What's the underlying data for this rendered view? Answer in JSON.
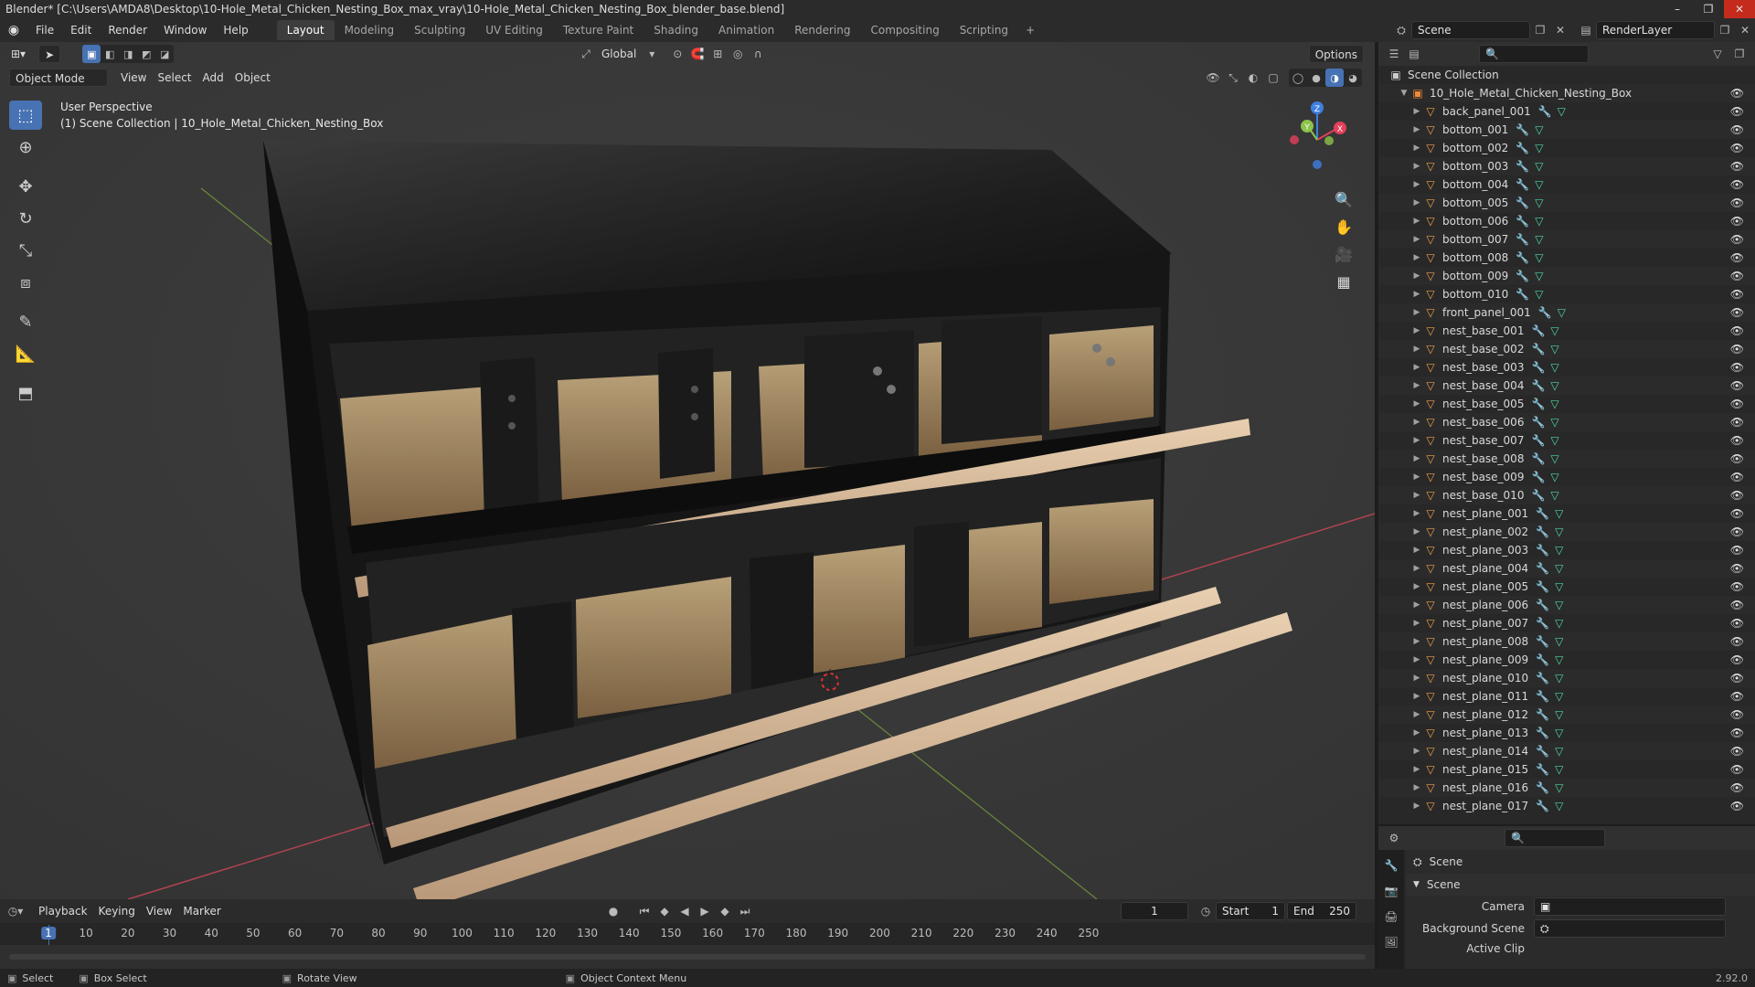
{
  "window": {
    "title": "Blender* [C:\\Users\\AMDA8\\Desktop\\10-Hole_Metal_Chicken_Nesting_Box_max_vray\\10-Hole_Metal_Chicken_Nesting_Box_blender_base.blend]",
    "controls": [
      "–",
      "❐",
      "✕"
    ]
  },
  "menu": [
    "File",
    "Edit",
    "Render",
    "Window",
    "Help"
  ],
  "workspaces": [
    {
      "label": "Layout",
      "active": true
    },
    {
      "label": "Modeling"
    },
    {
      "label": "Sculpting"
    },
    {
      "label": "UV Editing"
    },
    {
      "label": "Texture Paint"
    },
    {
      "label": "Shading"
    },
    {
      "label": "Animation"
    },
    {
      "label": "Rendering"
    },
    {
      "label": "Compositing"
    },
    {
      "label": "Scripting"
    }
  ],
  "topright": {
    "scene": "Scene",
    "view_layer": "RenderLayer"
  },
  "viewport": {
    "transform_orientation": "Global",
    "options_label": "Options",
    "mode": "Object Mode",
    "menus": [
      "View",
      "Select",
      "Add",
      "Object"
    ],
    "perspective_label": "User Perspective",
    "collection_label": "(1) Scene Collection | 10_Hole_Metal_Chicken_Nesting_Box"
  },
  "outliner": {
    "root": "Scene Collection",
    "collection": "10_Hole_Metal_Chicken_Nesting_Box",
    "items": [
      "back_panel_001",
      "bottom_001",
      "bottom_002",
      "bottom_003",
      "bottom_004",
      "bottom_005",
      "bottom_006",
      "bottom_007",
      "bottom_008",
      "bottom_009",
      "bottom_010",
      "front_panel_001",
      "nest_base_001",
      "nest_base_002",
      "nest_base_003",
      "nest_base_004",
      "nest_base_005",
      "nest_base_006",
      "nest_base_007",
      "nest_base_008",
      "nest_base_009",
      "nest_base_010",
      "nest_plane_001",
      "nest_plane_002",
      "nest_plane_003",
      "nest_plane_004",
      "nest_plane_005",
      "nest_plane_006",
      "nest_plane_007",
      "nest_plane_008",
      "nest_plane_009",
      "nest_plane_010",
      "nest_plane_011",
      "nest_plane_012",
      "nest_plane_013",
      "nest_plane_014",
      "nest_plane_015",
      "nest_plane_016",
      "nest_plane_017"
    ]
  },
  "properties": {
    "context": "Scene",
    "panel": "Scene",
    "camera_label": "Camera",
    "background_label": "Background Scene",
    "clip_label": "Active Clip"
  },
  "timeline": {
    "menus": [
      "Playback",
      "Keying",
      "View",
      "Marker"
    ],
    "current_frame": "1",
    "start_label": "Start",
    "start": "1",
    "end_label": "End",
    "end": "250",
    "ticks": [
      "1",
      "10",
      "20",
      "30",
      "40",
      "50",
      "60",
      "70",
      "80",
      "90",
      "100",
      "110",
      "120",
      "130",
      "140",
      "150",
      "160",
      "170",
      "180",
      "190",
      "200",
      "210",
      "220",
      "230",
      "240",
      "250"
    ]
  },
  "status": {
    "items": [
      "Select",
      "Box Select",
      "Rotate View",
      "Object Context Menu"
    ],
    "version": "2.92.0"
  },
  "colors": {
    "accent": "#4772b3",
    "object_orange": "#f0a04b",
    "mesh_green": "#4fd9a0",
    "modifier_blue": "#7ea1ff",
    "x_axis": "#e2405a",
    "y_axis": "#8bc34a",
    "z_axis": "#3f7fe0"
  }
}
